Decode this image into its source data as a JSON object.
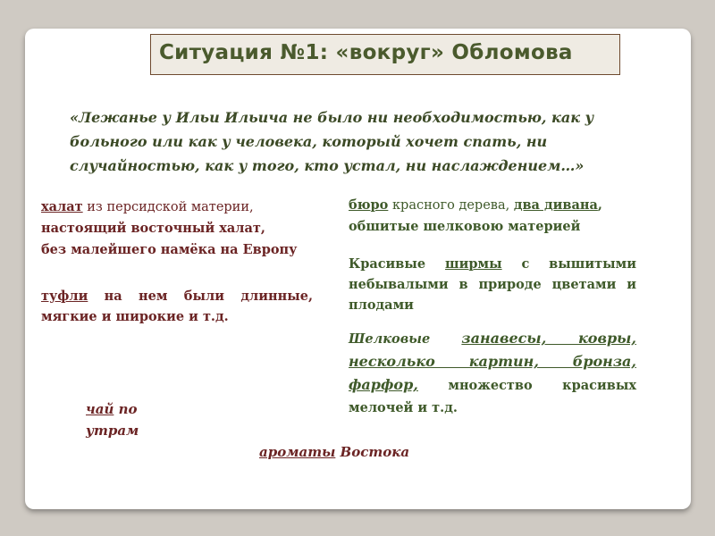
{
  "slide": {
    "title": "Ситуация №1: «вокруг» Обломова",
    "quote": "«Лежанье у Ильи Ильича не было ни необходимостью, как у больного или как у человека, который хочет спать, ни случайностью, как у того, кто устал, ни наслаждением…»",
    "left": {
      "khalat_word": "халат",
      "khalat_rest": " из персидской материи,",
      "line2": "настоящий восточный халат,",
      "line3": "без малейшего намёка на Европу",
      "tufli_word": "туфли",
      "tufli_rest": " на нем были длинные, мягкие и широкие и т.д."
    },
    "right": {
      "buro_word": "бюро",
      "buro_rest": " красного дерева, ",
      "dva_divana": "два дивана",
      "divany_rest": ",",
      "obshitye": "обшитые шелковою материей",
      "krasivye": "Красивые ",
      "shirmy": "ширмы",
      "shirmy_rest": " с вышитыми небывалыми в природе цветами и плодами",
      "shelkovye": "Шелковые ",
      "zanavesy": "занавесы, ковры, несколько картин, бронза, фарфор,",
      "zanavesy_rest": " множество красивых мелочей и т.д."
    },
    "tea": {
      "word": "чай",
      "rest": " по утрам"
    },
    "aroma": {
      "word": "ароматы",
      "rest": " Востока"
    }
  },
  "colors": {
    "background": "#cfcac3",
    "title_green": "#4a5a2d",
    "maroon": "#6b2424",
    "green": "#3f5a2a"
  }
}
